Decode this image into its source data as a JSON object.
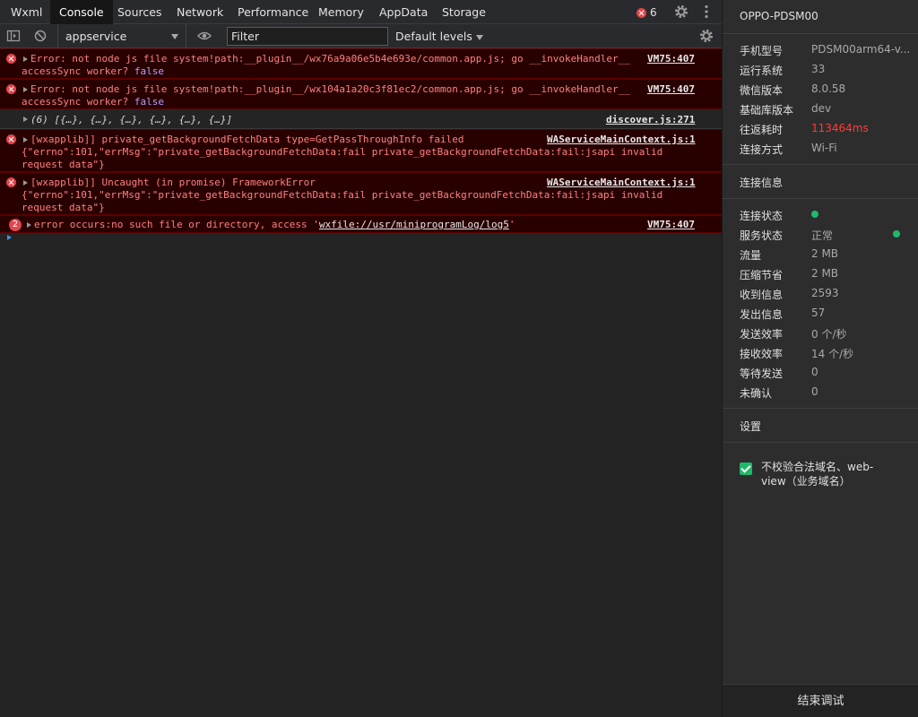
{
  "tabs": [
    {
      "label": "Wxml"
    },
    {
      "label": "Console"
    },
    {
      "label": "Sources"
    },
    {
      "label": "Network"
    },
    {
      "label": "Performance"
    },
    {
      "label": "Memory"
    },
    {
      "label": "AppData"
    },
    {
      "label": "Storage"
    }
  ],
  "active_tab": "Console",
  "error_count": "6",
  "toolbar": {
    "context": "appservice",
    "filter_placeholder": "Filter",
    "levels": "Default levels"
  },
  "messages": [
    {
      "lines": [
        "Error: not node js file system!path:__plugin__/wx76a9a06e5b4e693e/common.app.js; go __invokeHandler__",
        "accessSync worker? "
      ],
      "kw": "false",
      "source": "VM75:407"
    },
    {
      "lines": [
        "Error: not node js file system!path:__plugin__/wx104a1a20c3f81ec2/common.app.js; go __invokeHandler__",
        "accessSync worker? "
      ],
      "kw": "false",
      "source": "VM75:407"
    },
    {
      "lines": [
        "(6) [{…}, {…}, {…}, {…}, {…}, {…}]"
      ],
      "source": "discover.js:271"
    },
    {
      "lines": [
        "[wxapplib]] private_getBackgroundFetchData type=GetPassThroughInfo failed",
        "{\"errno\":101,\"errMsg\":\"private_getBackgroundFetchData:fail private_getBackgroundFetchData:fail:jsapi invalid",
        "request data\"}"
      ],
      "source": "WAServiceMainContext.js:1"
    },
    {
      "lines": [
        "[wxapplib]] Uncaught (in promise) FrameworkError",
        "{\"errno\":101,\"errMsg\":\"private_getBackgroundFetchData:fail private_getBackgroundFetchData:fail:jsapi invalid",
        "request data\"}"
      ],
      "source": "WAServiceMainContext.js:1"
    },
    {
      "count": "2",
      "prefix": "error occurs:no such file or directory, access '",
      "link": "wxfile://usr/miniprogramLog/log5",
      "suffix": "'",
      "source": "VM75:407"
    }
  ],
  "panel": {
    "device": "OPPO-PDSM00",
    "info": [
      {
        "label": "手机型号",
        "value": "PDSM00arm64-v..."
      },
      {
        "label": "运行系统",
        "value": "33"
      },
      {
        "label": "微信版本",
        "value": "8.0.58"
      },
      {
        "label": "基础库版本",
        "value": "dev"
      },
      {
        "label": "往返耗时",
        "value": "113464ms"
      },
      {
        "label": "连接方式",
        "value": "Wi-Fi"
      }
    ],
    "conn_title": "连接信息",
    "conn": [
      {
        "label": "连接状态",
        "value": ""
      },
      {
        "label": "服务状态",
        "value": "正常"
      },
      {
        "label": "流量",
        "value": "2 MB"
      },
      {
        "label": "压缩节省",
        "value": "2 MB"
      },
      {
        "label": "收到信息",
        "value": "2593"
      },
      {
        "label": "发出信息",
        "value": "57"
      },
      {
        "label": "发送效率",
        "value": "0 个/秒"
      },
      {
        "label": "接收效率",
        "value": "14 个/秒"
      },
      {
        "label": "等待发送",
        "value": "0"
      },
      {
        "label": "未确认",
        "value": "0"
      }
    ],
    "settings_title": "设置",
    "checkbox_label": "不校验合法域名、web-view（业务域名）",
    "end_button": "结束调试"
  },
  "colors": {
    "error_text": "#ff8080",
    "status_green": "#1fb86a",
    "latency_red": "#ff3b3b"
  }
}
